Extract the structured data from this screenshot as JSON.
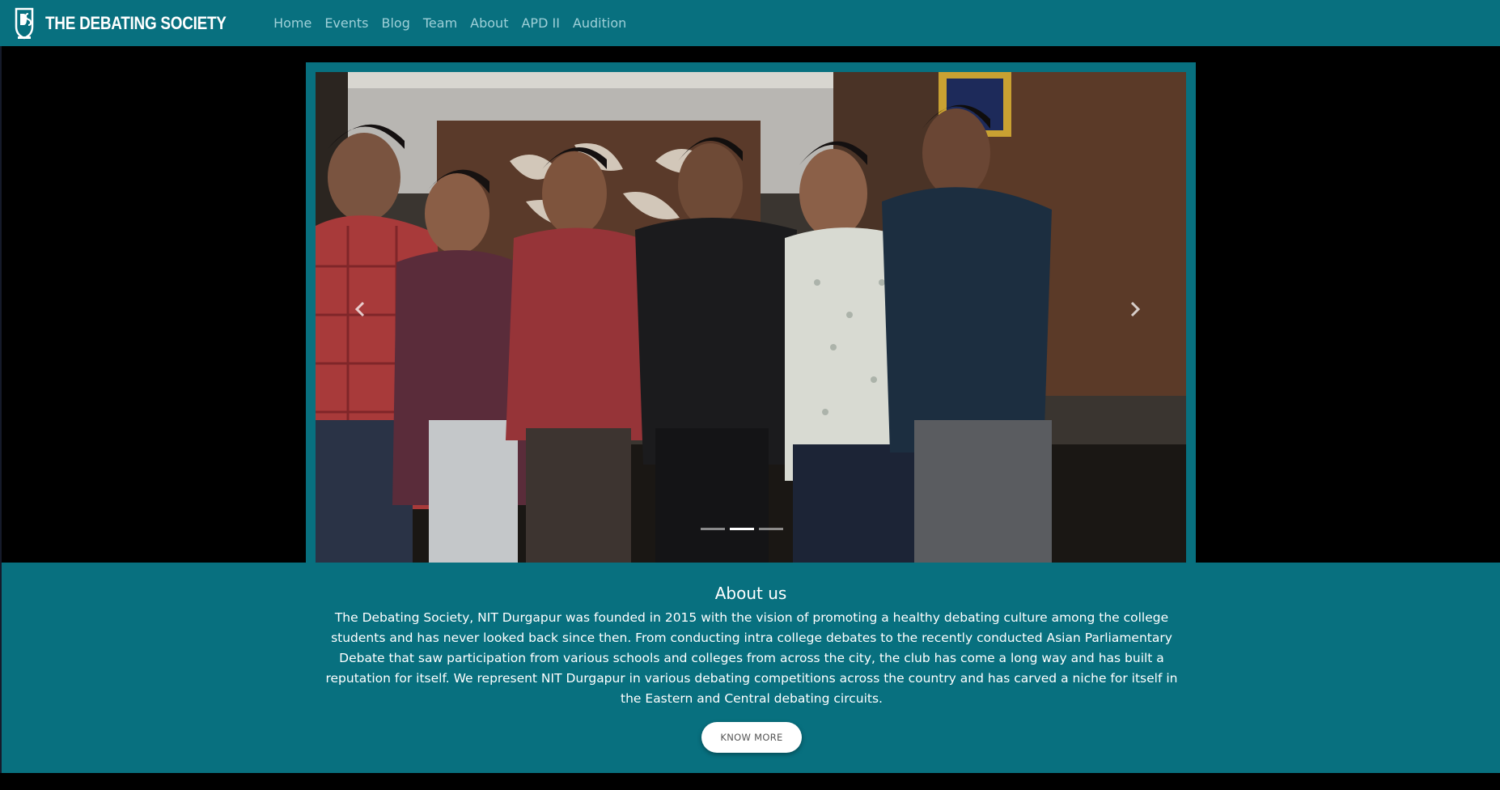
{
  "brand": {
    "name": "THE DEBATING SOCIETY",
    "logo_icon": "ds-crest-icon"
  },
  "nav": {
    "links": [
      "Home",
      "Events",
      "Blog",
      "Team",
      "About",
      "APD II",
      "Audition"
    ]
  },
  "carousel": {
    "slide_count": 3,
    "active_index": 1,
    "prev_icon": "chevron-left-icon",
    "next_icon": "chevron-right-icon"
  },
  "about": {
    "title": "About us",
    "text": "The Debating Society, NIT Durgapur was founded in 2015 with the vision of promoting a healthy debating culture among the college students and has never looked back since then. From conducting intra college debates to the recently conducted Asian Parliamentary Debate that saw participation from various schools and colleges from across the city, the club has come a long way and has built a reputation for itself. We represent NIT Durgapur in various debating competitions across the country and has carved a niche for itself in the Eastern and Central debating circuits.",
    "button": "KNOW MORE"
  },
  "colors": {
    "teal": "#08707f",
    "nav_link": "#9ed0d8",
    "background": "#000000"
  }
}
